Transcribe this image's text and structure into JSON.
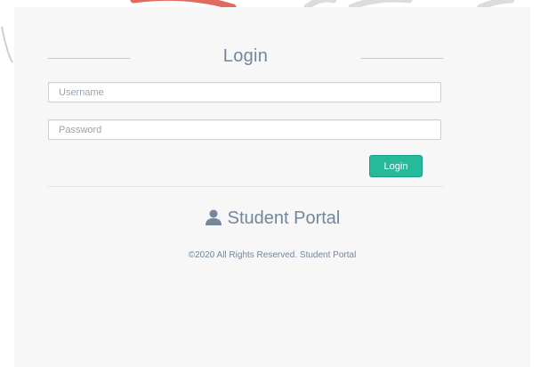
{
  "login": {
    "title": "Login",
    "username_placeholder": "Username",
    "password_placeholder": "Password",
    "button_label": "Login"
  },
  "brand": {
    "icon": "user-icon",
    "name": "Student Portal"
  },
  "footer": {
    "copyright": "©2020 All Rights Reserved. Student Portal"
  },
  "colors": {
    "accent": "#26b99a",
    "text": "#73879c",
    "panel_bg": "#f7f7f7",
    "decor": "#e74c3c"
  }
}
